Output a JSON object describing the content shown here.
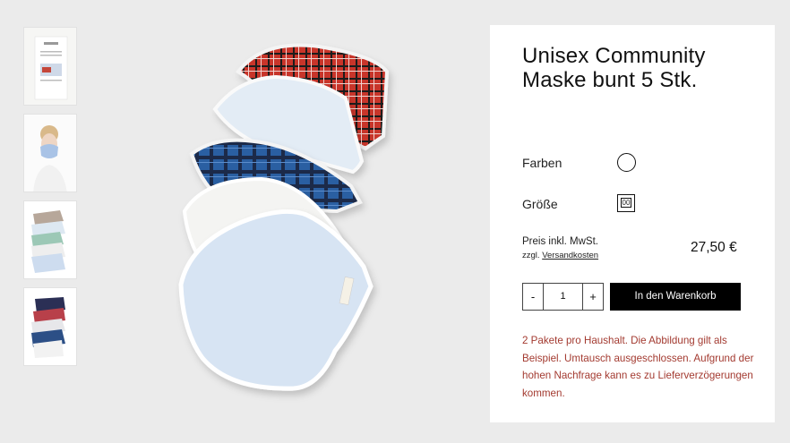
{
  "product": {
    "title": "Unisex Community Maske bunt 5 Stk."
  },
  "options": {
    "color_label": "Farben",
    "size_label": "Größe",
    "size_value": "00"
  },
  "pricing": {
    "price_label": "Preis inkl. MwSt.",
    "shipping_prefix": "zzgl.",
    "shipping_link": "Versandkosten",
    "price": "27,50 €"
  },
  "cart": {
    "minus": "-",
    "quantity": "1",
    "plus": "+",
    "add_label": "In den Warenkorb"
  },
  "notice": "2 Pakete pro Haushalt. Die Abbildung gilt als Beispiel. Umtausch ausgeschlossen. Aufgrund der hohen Nachfrage kann es zu Lieferverzögerungen kommen.",
  "colors": {
    "notice": "#a33a30",
    "button": "#000000",
    "background": "#ebebeb"
  }
}
